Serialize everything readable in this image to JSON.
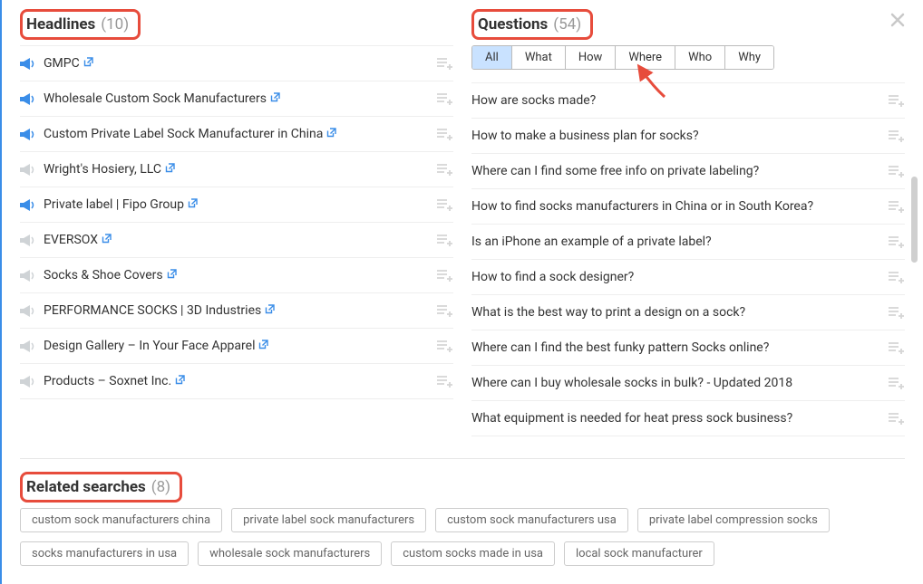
{
  "headlines": {
    "title": "Headlines",
    "count": "(10)",
    "items": [
      {
        "text": "GMPC",
        "colored": true
      },
      {
        "text": "Wholesale Custom Sock Manufacturers",
        "colored": true
      },
      {
        "text": "Custom Private Label Sock Manufacturer in China",
        "colored": true
      },
      {
        "text": "Wright's Hosiery, LLC",
        "colored": false
      },
      {
        "text": "Private label | Fipo Group",
        "colored": true
      },
      {
        "text": "EVERSOX",
        "colored": false
      },
      {
        "text": "Socks & Shoe Covers",
        "colored": false
      },
      {
        "text": "PERFORMANCE SOCKS | 3D Industries",
        "colored": false
      },
      {
        "text": "Design Gallery – In Your Face Apparel",
        "colored": false
      },
      {
        "text": "Products – Soxnet Inc.",
        "colored": false
      }
    ]
  },
  "questions": {
    "title": "Questions",
    "count": "(54)",
    "tabs": [
      "All",
      "What",
      "How",
      "Where",
      "Who",
      "Why"
    ],
    "active_tab": 0,
    "items": [
      "How are socks made?",
      "How to make a business plan for socks?",
      "Where can I find some free info on private labeling?",
      "How to find socks manufacturers in China or in South Korea?",
      "Is an iPhone an example of a private label?",
      "How to find a sock designer?",
      "What is the best way to print a design on a sock?",
      "Where can I find the best funky pattern Socks online?",
      "Where can I buy wholesale socks in bulk? - Updated 2018",
      "What equipment is needed for heat press sock business?"
    ]
  },
  "related": {
    "title": "Related searches",
    "count": "(8)",
    "items": [
      "custom sock manufacturers china",
      "private label sock manufacturers",
      "custom sock manufacturers usa",
      "private label compression socks",
      "socks manufacturers in usa",
      "wholesale sock manufacturers",
      "custom socks made in usa",
      "local sock manufacturer"
    ]
  },
  "colors": {
    "highlight": "#e74c3c",
    "link": "#3a8de8",
    "active_tab_bg": "#c9e2ff"
  }
}
